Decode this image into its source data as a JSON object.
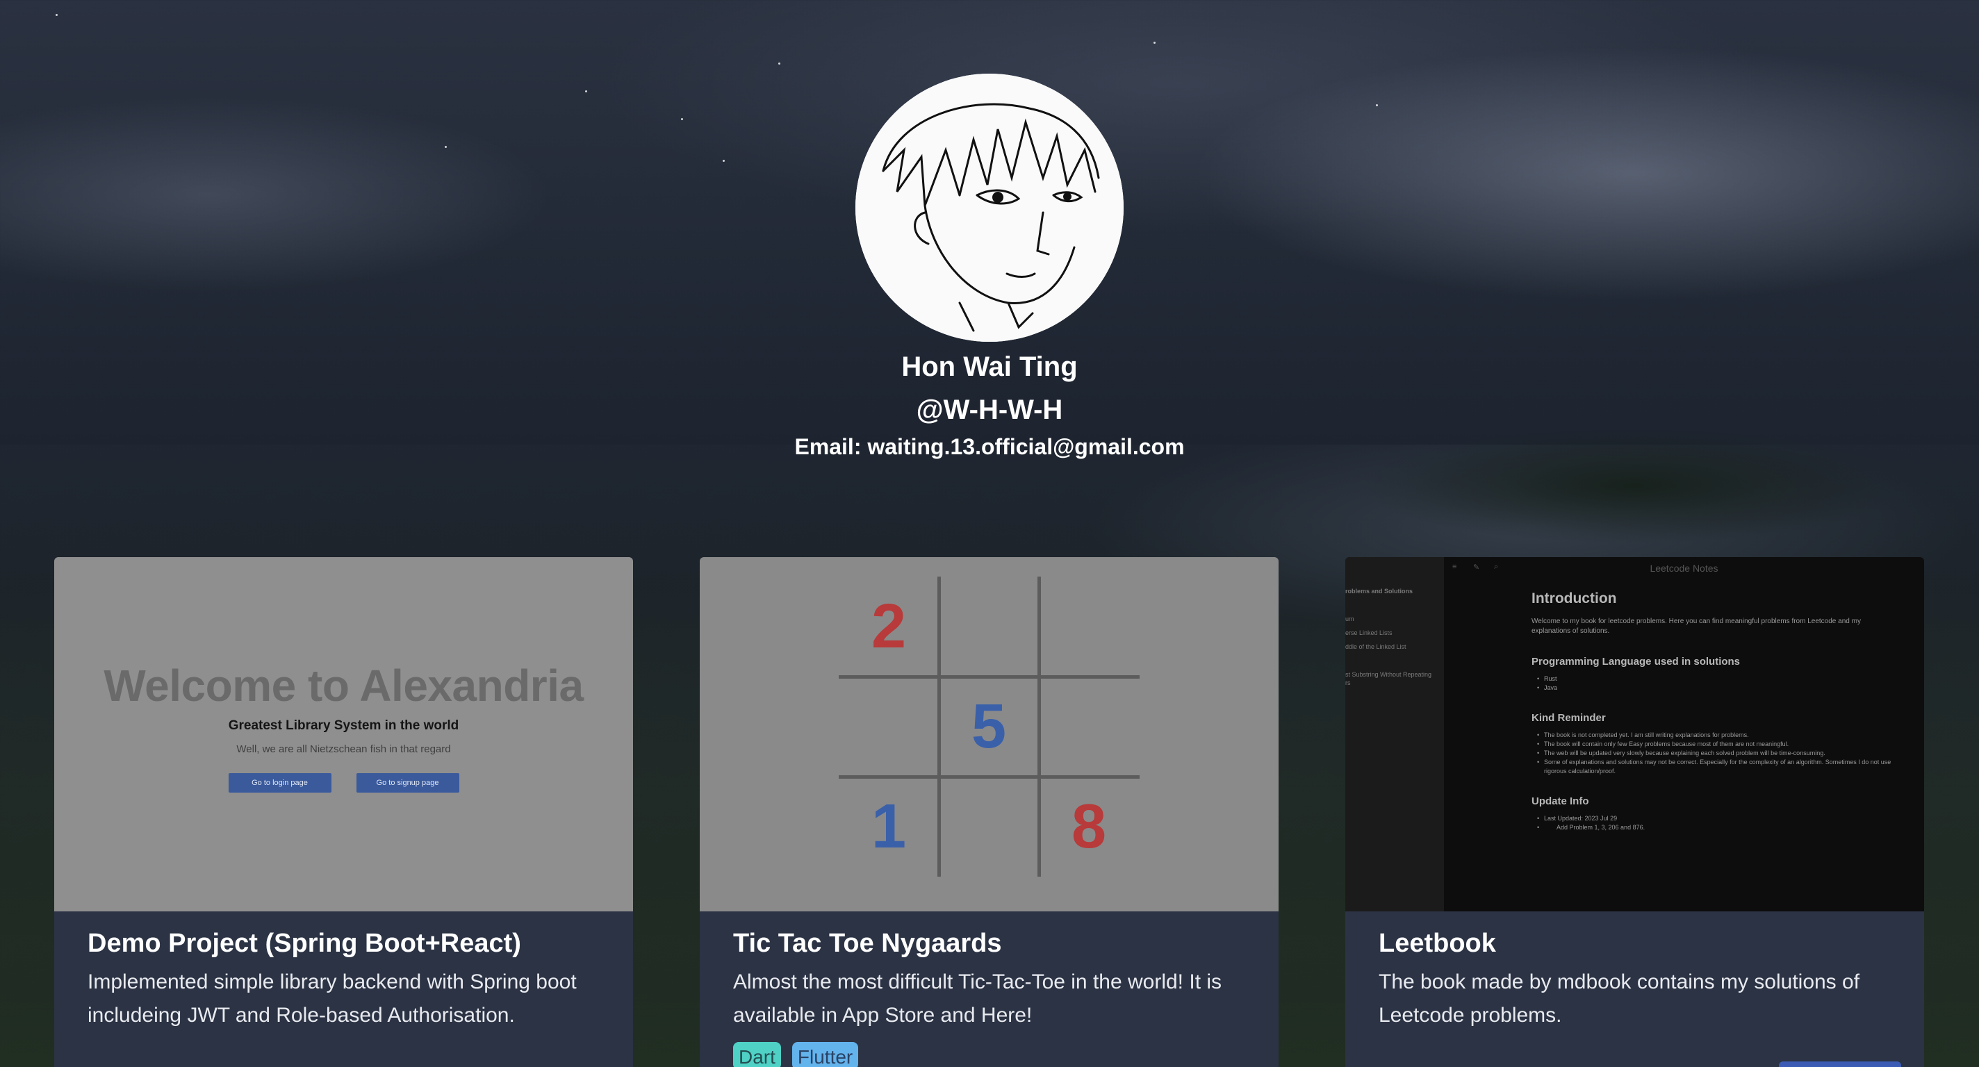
{
  "profile": {
    "name": "Hon Wai Ting",
    "handle": "@W-H-W-H",
    "email": "Email: waiting.13.official@gmail.com"
  },
  "projects": [
    {
      "title": "Demo Project (Spring Boot+React)",
      "description": "Implemented simple library backend with Spring boot includeing JWT and Role-based Authorisation.",
      "preview": {
        "heading": "Welcome to Alexandria",
        "subheading": "Greatest Library System in the world",
        "tagline": "Well, we are all Nietzschean fish in that regard",
        "login_button": "Go to login page",
        "signup_button": "Go to signup page"
      }
    },
    {
      "title": "Tic Tac Toe Nygaards",
      "description": "Almost the most difficult Tic-Tac-Toe in the world! It is available in App Store and Here!",
      "preview": {
        "cells": [
          "2",
          "",
          "",
          "",
          "5",
          "",
          "1",
          "",
          "8"
        ]
      },
      "tags": [
        "Dart",
        "Flutter"
      ]
    },
    {
      "title": "Leetbook",
      "description": "The book made by mdbook contains my solutions of Leetcode problems.",
      "preview": {
        "window_title": "Leetcode Notes",
        "sidebar_items": [
          "roblems and Solutions",
          "um",
          "erse Linked Lists",
          "ddle of the Linked List",
          "st Substring Without Repeating",
          "rs"
        ],
        "intro_heading": "Introduction",
        "intro_text": "Welcome to my book for leetcode problems. Here you can find meaningful problems from Leetcode and my explanations of solutions.",
        "lang_heading": "Programming Language used in solutions",
        "langs": [
          "Rust",
          "Java"
        ],
        "reminder_heading": "Kind Reminder",
        "reminders": [
          "The book is not completed yet. I am still writing explanations for problems.",
          "The book will contain only few Easy problems because most of them are not meaningful.",
          "The web will be updated very slowly because explaining each solved problem will be time-consuming.",
          "Some of explanations and solutions may not be correct. Especially for the complexity of an algorithm. Sometimes I do not use rigorous calculation/proof."
        ],
        "update_heading": "Update Info",
        "updates": [
          "Last Updated: 2023 Jul 29",
          "Add Problem 1, 3, 206 and 876."
        ]
      }
    }
  ]
}
